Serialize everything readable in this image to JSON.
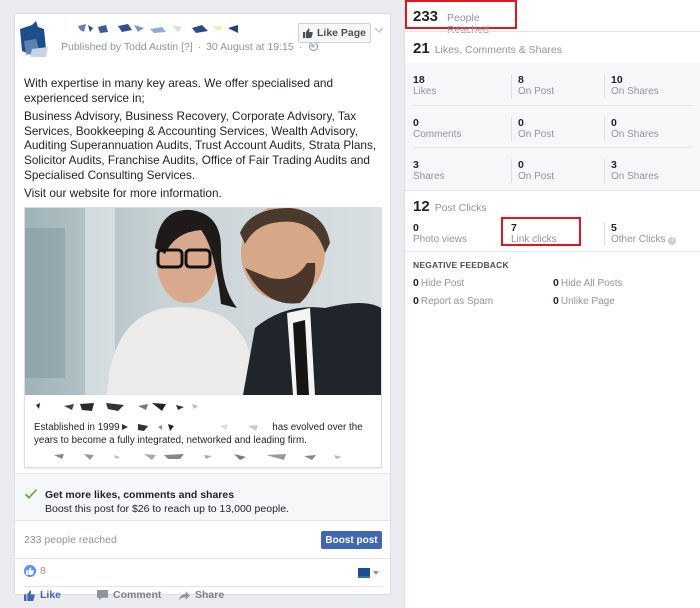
{
  "post": {
    "byline": {
      "published_by": "Published by Todd Austin",
      "help_marker": "[?]",
      "separator": "·",
      "date": "30 August at 19:15",
      "audience_icon": "globe-icon"
    },
    "like_page_label": "Like Page",
    "body": [
      "With expertise in many key areas. We offer specialised and experienced service in;",
      "Business Advisory, Business Recovery, Corporate Advisory, Tax Services, Bookkeeping & Accounting Services, Wealth Advisory, Auditing Superannuation Audits, Trust Account Audits, Strata Plans, Solicitor Audits, Franchise Audits, Office of Fair Trading Audits and Specialised Consulting Services.",
      "Visit our website for more information."
    ],
    "link_preview": {
      "description_start": "Established in 1999",
      "description_end": "has evolved over the years to become a fully integrated, networked and leading firm."
    },
    "promo": {
      "title": "Get more likes, comments and shares",
      "subtitle": "Boost this post for $26 to reach up to 13,000 people."
    },
    "reach_text": "233 people reached",
    "boost_label": "Boost post",
    "like_count": "8",
    "actions": {
      "like": "Like",
      "comment": "Comment",
      "share": "Share"
    }
  },
  "insights": {
    "people_reached": {
      "value": "233",
      "label": "People Reached"
    },
    "engagement": {
      "value": "21",
      "label": "Likes, Comments & Shares"
    },
    "stats": [
      [
        {
          "value": "18",
          "label": "Likes"
        },
        {
          "value": "8",
          "label": "On Post"
        },
        {
          "value": "10",
          "label": "On Shares"
        }
      ],
      [
        {
          "value": "0",
          "label": "Comments"
        },
        {
          "value": "0",
          "label": "On Post"
        },
        {
          "value": "0",
          "label": "On Shares"
        }
      ],
      [
        {
          "value": "3",
          "label": "Shares"
        },
        {
          "value": "0",
          "label": "On Post"
        },
        {
          "value": "3",
          "label": "On Shares"
        }
      ]
    ],
    "post_clicks": {
      "value": "12",
      "label": "Post Clicks"
    },
    "clicks": [
      {
        "value": "0",
        "label": "Photo views"
      },
      {
        "value": "7",
        "label": "Link clicks"
      },
      {
        "value": "5",
        "label": "Other Clicks"
      }
    ],
    "negative_feedback": {
      "title": "NEGATIVE FEEDBACK",
      "items": [
        {
          "value": "0",
          "label": "Hide Post"
        },
        {
          "value": "0",
          "label": "Hide All Posts"
        },
        {
          "value": "0",
          "label": "Report as Spam"
        },
        {
          "value": "0",
          "label": "Unlike Page"
        }
      ]
    }
  },
  "colors": {
    "brand_blue": "#4267b2",
    "highlight_red": "#e0171f",
    "check_green": "#5dad2f",
    "muted_text": "#90949c"
  }
}
